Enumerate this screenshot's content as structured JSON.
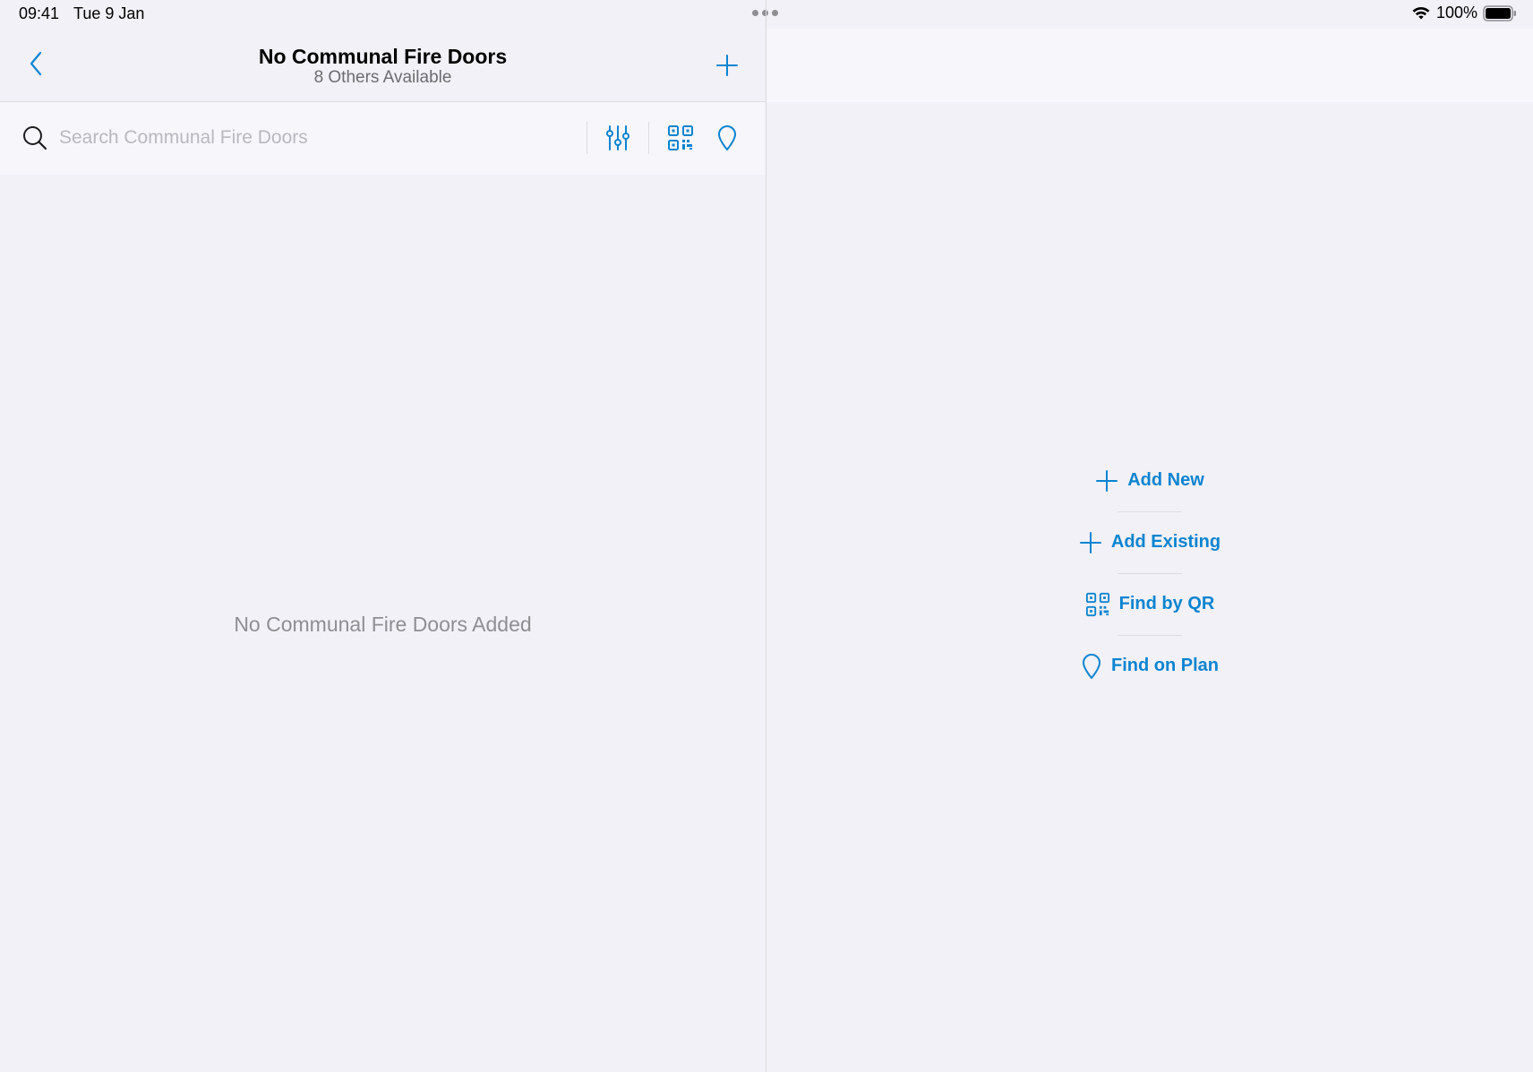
{
  "status_bar": {
    "time": "09:41",
    "date": "Tue 9 Jan",
    "battery": "100%"
  },
  "header": {
    "title": "No Communal Fire Doors",
    "subtitle": "8 Others Available"
  },
  "search": {
    "placeholder": "Search Communal Fire Doors",
    "value": ""
  },
  "list": {
    "empty_message": "No Communal Fire Doors Added"
  },
  "actions": [
    {
      "label": "Add New",
      "icon": "plus-icon"
    },
    {
      "label": "Add Existing",
      "icon": "plus-icon"
    },
    {
      "label": "Find by QR",
      "icon": "qr-code-icon"
    },
    {
      "label": "Find on Plan",
      "icon": "map-pin-icon"
    }
  ],
  "colors": {
    "accent": "#0a84d0",
    "background": "#f2f1f7",
    "secondary_text": "#8e8e93"
  }
}
